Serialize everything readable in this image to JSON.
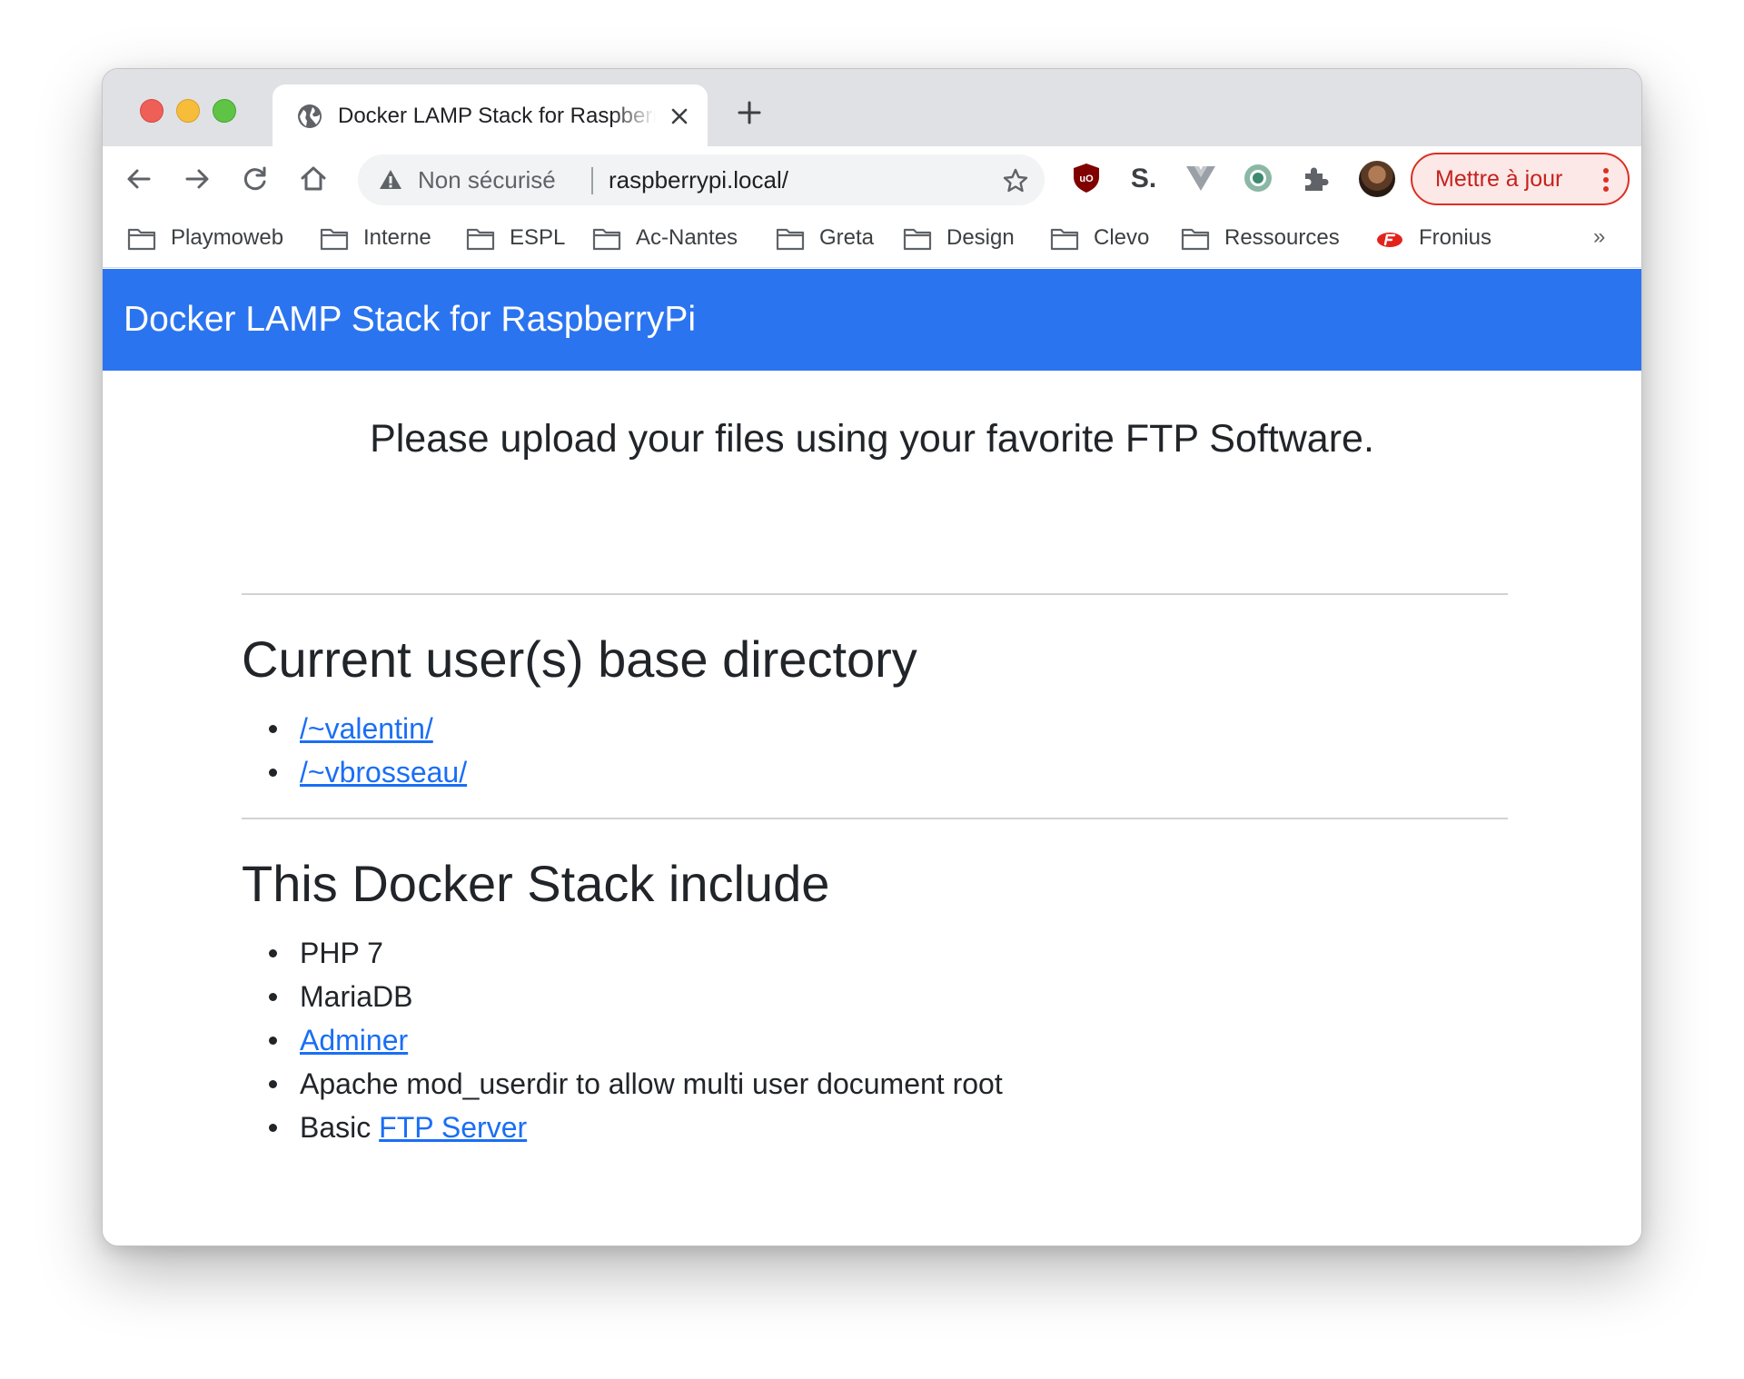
{
  "browser": {
    "tab": {
      "title": "Docker LAMP Stack for Raspberry",
      "icon": "globe-icon"
    },
    "omnibox": {
      "security_label": "Non sécurisé",
      "url": "raspberrypi.local/"
    },
    "update_button": "Mettre à jour",
    "bookmarks": [
      {
        "label": "Playmoweb",
        "icon": "folder-icon"
      },
      {
        "label": "Interne",
        "icon": "folder-icon"
      },
      {
        "label": "ESPL",
        "icon": "folder-icon"
      },
      {
        "label": "Ac-Nantes",
        "icon": "folder-icon"
      },
      {
        "label": "Greta",
        "icon": "folder-icon"
      },
      {
        "label": "Design",
        "icon": "folder-icon"
      },
      {
        "label": "Clevo",
        "icon": "folder-icon"
      },
      {
        "label": "Ressources",
        "icon": "folder-icon"
      },
      {
        "label": "Fronius",
        "icon": "fronius-logo-icon"
      }
    ],
    "bookmarks_overflow": "»",
    "colors": {
      "update_red": "#d93025",
      "tab_strip": "#dfe1e5"
    }
  },
  "page": {
    "navbar_brand": "Docker LAMP Stack for RaspberryPi",
    "lead": "Please upload your files using your favorite FTP Software.",
    "users_heading": "Current user(s) base directory",
    "users": [
      "/~valentin/",
      "/~vbrosseau/"
    ],
    "stack_heading": "This Docker Stack include",
    "stack_items": {
      "php": "PHP 7",
      "mariadb": "MariaDB",
      "adminer": "Adminer",
      "userdir": "Apache mod_userdir to allow multi user document root",
      "ftp_prefix": "Basic ",
      "ftp_link": "FTP Server"
    },
    "colors": {
      "navbar": "#2b74f0",
      "link": "#1a6ef5",
      "text": "#212529"
    }
  }
}
